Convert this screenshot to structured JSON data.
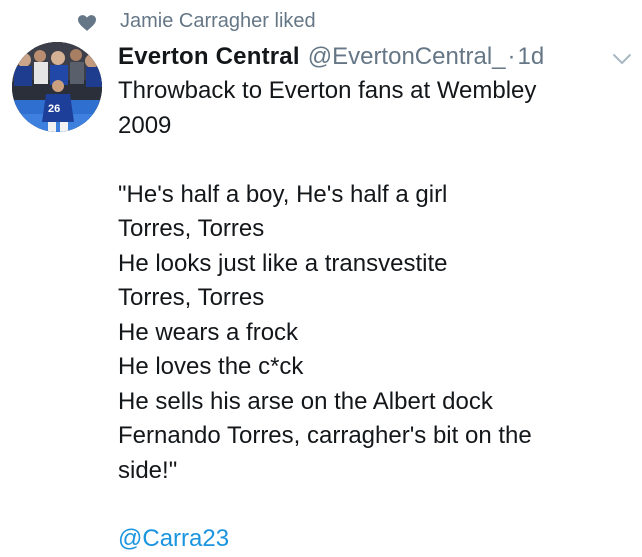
{
  "social_context": {
    "icon": "heart-icon",
    "text": "Jamie Carragher liked"
  },
  "author": {
    "avatar_icon": "avatar-image",
    "display_name": "Everton Central",
    "handle": "@EvertonCentral_",
    "separator": "·",
    "time": "1d"
  },
  "tweet": {
    "lines": [
      "Throwback to Everton fans at Wembley",
      "2009",
      "",
      "\"He's half a boy, He's half a girl",
      "Torres, Torres",
      "He looks just like a transvestite",
      "Torres, Torres",
      "He wears a frock",
      "He loves the c*ck",
      "He sells his arse on the Albert dock",
      "Fernando Torres, carragher's bit on the",
      "side!\""
    ],
    "mention": "@Carra23"
  },
  "colors": {
    "text": "#14171a",
    "secondary": "#657786",
    "link": "#1b95e0"
  }
}
